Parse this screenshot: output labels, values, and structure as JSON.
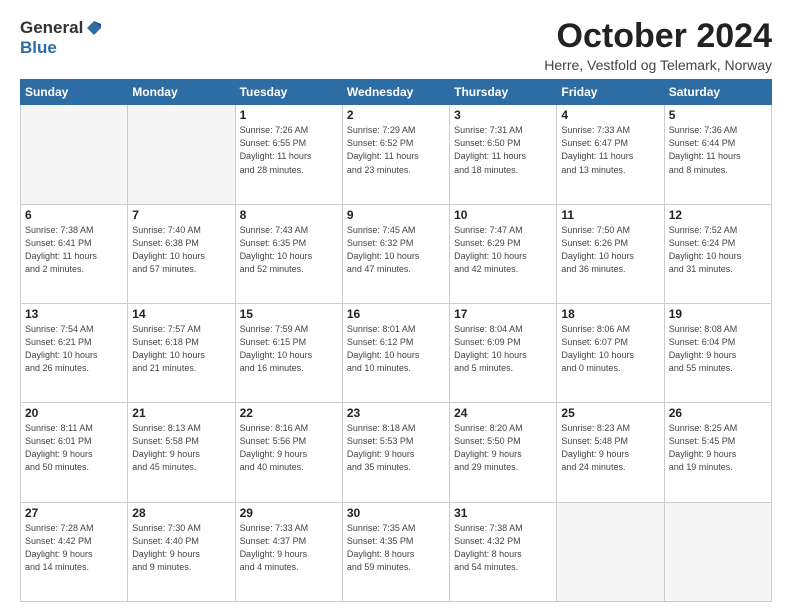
{
  "logo": {
    "general": "General",
    "blue": "Blue"
  },
  "title": "October 2024",
  "location": "Herre, Vestfold og Telemark, Norway",
  "days_header": [
    "Sunday",
    "Monday",
    "Tuesday",
    "Wednesday",
    "Thursday",
    "Friday",
    "Saturday"
  ],
  "weeks": [
    [
      {
        "day": "",
        "info": ""
      },
      {
        "day": "",
        "info": ""
      },
      {
        "day": "1",
        "info": "Sunrise: 7:26 AM\nSunset: 6:55 PM\nDaylight: 11 hours\nand 28 minutes."
      },
      {
        "day": "2",
        "info": "Sunrise: 7:29 AM\nSunset: 6:52 PM\nDaylight: 11 hours\nand 23 minutes."
      },
      {
        "day": "3",
        "info": "Sunrise: 7:31 AM\nSunset: 6:50 PM\nDaylight: 11 hours\nand 18 minutes."
      },
      {
        "day": "4",
        "info": "Sunrise: 7:33 AM\nSunset: 6:47 PM\nDaylight: 11 hours\nand 13 minutes."
      },
      {
        "day": "5",
        "info": "Sunrise: 7:36 AM\nSunset: 6:44 PM\nDaylight: 11 hours\nand 8 minutes."
      }
    ],
    [
      {
        "day": "6",
        "info": "Sunrise: 7:38 AM\nSunset: 6:41 PM\nDaylight: 11 hours\nand 2 minutes."
      },
      {
        "day": "7",
        "info": "Sunrise: 7:40 AM\nSunset: 6:38 PM\nDaylight: 10 hours\nand 57 minutes."
      },
      {
        "day": "8",
        "info": "Sunrise: 7:43 AM\nSunset: 6:35 PM\nDaylight: 10 hours\nand 52 minutes."
      },
      {
        "day": "9",
        "info": "Sunrise: 7:45 AM\nSunset: 6:32 PM\nDaylight: 10 hours\nand 47 minutes."
      },
      {
        "day": "10",
        "info": "Sunrise: 7:47 AM\nSunset: 6:29 PM\nDaylight: 10 hours\nand 42 minutes."
      },
      {
        "day": "11",
        "info": "Sunrise: 7:50 AM\nSunset: 6:26 PM\nDaylight: 10 hours\nand 36 minutes."
      },
      {
        "day": "12",
        "info": "Sunrise: 7:52 AM\nSunset: 6:24 PM\nDaylight: 10 hours\nand 31 minutes."
      }
    ],
    [
      {
        "day": "13",
        "info": "Sunrise: 7:54 AM\nSunset: 6:21 PM\nDaylight: 10 hours\nand 26 minutes."
      },
      {
        "day": "14",
        "info": "Sunrise: 7:57 AM\nSunset: 6:18 PM\nDaylight: 10 hours\nand 21 minutes."
      },
      {
        "day": "15",
        "info": "Sunrise: 7:59 AM\nSunset: 6:15 PM\nDaylight: 10 hours\nand 16 minutes."
      },
      {
        "day": "16",
        "info": "Sunrise: 8:01 AM\nSunset: 6:12 PM\nDaylight: 10 hours\nand 10 minutes."
      },
      {
        "day": "17",
        "info": "Sunrise: 8:04 AM\nSunset: 6:09 PM\nDaylight: 10 hours\nand 5 minutes."
      },
      {
        "day": "18",
        "info": "Sunrise: 8:06 AM\nSunset: 6:07 PM\nDaylight: 10 hours\nand 0 minutes."
      },
      {
        "day": "19",
        "info": "Sunrise: 8:08 AM\nSunset: 6:04 PM\nDaylight: 9 hours\nand 55 minutes."
      }
    ],
    [
      {
        "day": "20",
        "info": "Sunrise: 8:11 AM\nSunset: 6:01 PM\nDaylight: 9 hours\nand 50 minutes."
      },
      {
        "day": "21",
        "info": "Sunrise: 8:13 AM\nSunset: 5:58 PM\nDaylight: 9 hours\nand 45 minutes."
      },
      {
        "day": "22",
        "info": "Sunrise: 8:16 AM\nSunset: 5:56 PM\nDaylight: 9 hours\nand 40 minutes."
      },
      {
        "day": "23",
        "info": "Sunrise: 8:18 AM\nSunset: 5:53 PM\nDaylight: 9 hours\nand 35 minutes."
      },
      {
        "day": "24",
        "info": "Sunrise: 8:20 AM\nSunset: 5:50 PM\nDaylight: 9 hours\nand 29 minutes."
      },
      {
        "day": "25",
        "info": "Sunrise: 8:23 AM\nSunset: 5:48 PM\nDaylight: 9 hours\nand 24 minutes."
      },
      {
        "day": "26",
        "info": "Sunrise: 8:25 AM\nSunset: 5:45 PM\nDaylight: 9 hours\nand 19 minutes."
      }
    ],
    [
      {
        "day": "27",
        "info": "Sunrise: 7:28 AM\nSunset: 4:42 PM\nDaylight: 9 hours\nand 14 minutes."
      },
      {
        "day": "28",
        "info": "Sunrise: 7:30 AM\nSunset: 4:40 PM\nDaylight: 9 hours\nand 9 minutes."
      },
      {
        "day": "29",
        "info": "Sunrise: 7:33 AM\nSunset: 4:37 PM\nDaylight: 9 hours\nand 4 minutes."
      },
      {
        "day": "30",
        "info": "Sunrise: 7:35 AM\nSunset: 4:35 PM\nDaylight: 8 hours\nand 59 minutes."
      },
      {
        "day": "31",
        "info": "Sunrise: 7:38 AM\nSunset: 4:32 PM\nDaylight: 8 hours\nand 54 minutes."
      },
      {
        "day": "",
        "info": ""
      },
      {
        "day": "",
        "info": ""
      }
    ]
  ]
}
